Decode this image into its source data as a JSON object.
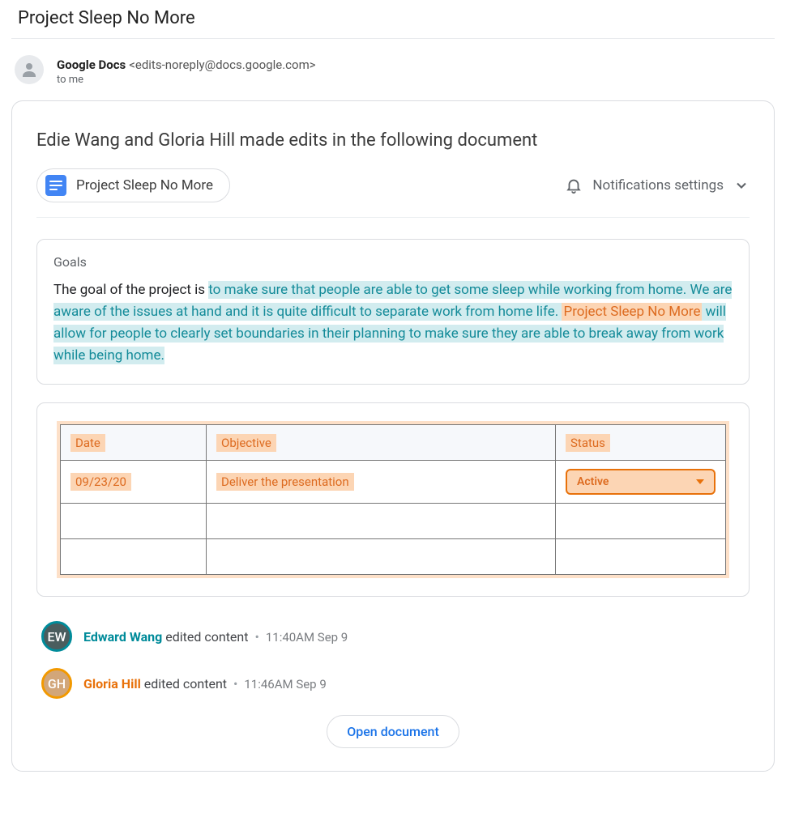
{
  "email": {
    "subject": "Project Sleep No More",
    "sender_name": "Google Docs",
    "sender_email": "<edits-noreply@docs.google.com>",
    "to": "to me"
  },
  "card": {
    "headline": "Edie Wang and Gloria Hill made edits in the following document",
    "doc_title": "Project Sleep No More",
    "notifications_label": "Notifications settings"
  },
  "goals": {
    "title": "Goals",
    "prefix": "The goal of the project is ",
    "teal1": "to make sure that people are able to get some sleep while working from home. We are aware of the issues at hand and it is quite difficult to separate work from home life. ",
    "orange": "Project Sleep No More",
    "teal2": " will allow for people to clearly set boundaries in their planning to make sure they are able to break away from work while being home."
  },
  "table": {
    "headers": {
      "date": "Date",
      "objective": "Objective",
      "status": "Status"
    },
    "rows": [
      {
        "date": "09/23/20",
        "objective": "Deliver the presentation",
        "status": "Active"
      },
      {
        "date": "",
        "objective": "",
        "status": ""
      },
      {
        "date": "",
        "objective": "",
        "status": ""
      }
    ]
  },
  "editors": [
    {
      "name": "Edward Wang",
      "initials": "EW",
      "color": "teal",
      "action": "edited content",
      "time": "11:40AM Sep 9"
    },
    {
      "name": "Gloria Hill",
      "initials": "GH",
      "color": "orange",
      "action": "edited content",
      "time": "11:46AM Sep 9"
    }
  ],
  "open_button": "Open document"
}
